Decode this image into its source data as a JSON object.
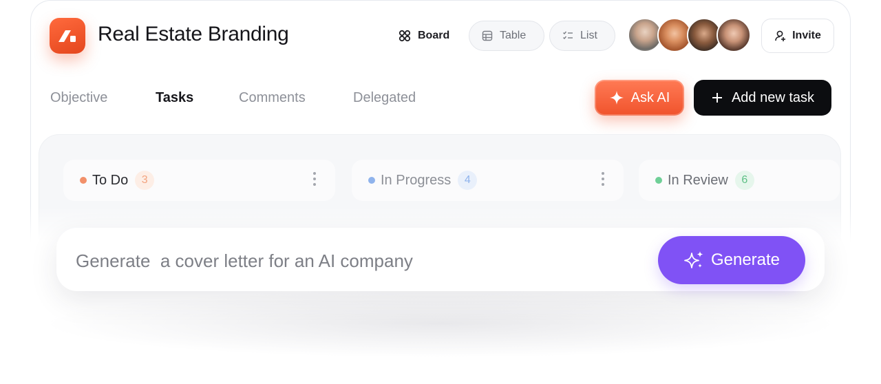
{
  "project": {
    "title": "Real Estate Branding"
  },
  "views": {
    "board_label": "Board",
    "table_label": "Table",
    "list_label": "List"
  },
  "invite_label": "Invite",
  "tabs": [
    {
      "label": "Objective"
    },
    {
      "label": "Tasks"
    },
    {
      "label": "Comments"
    },
    {
      "label": "Delegated"
    }
  ],
  "actions": {
    "ask_ai_label": "Ask AI",
    "add_task_label": "Add new task"
  },
  "columns": [
    {
      "label": "To Do",
      "count": "3",
      "color": "#f2906a"
    },
    {
      "label": "In Progress",
      "count": "4",
      "color": "#8fb3ec"
    },
    {
      "label": "In Review",
      "count": "6",
      "color": "#6fcf97"
    }
  ],
  "generator": {
    "input_value": "Generate  a cover letter for an AI company",
    "button_label": "Generate"
  },
  "colors": {
    "brand": "#ef5a2f",
    "generate": "#8052f5",
    "dark_button": "#0c0d10"
  }
}
